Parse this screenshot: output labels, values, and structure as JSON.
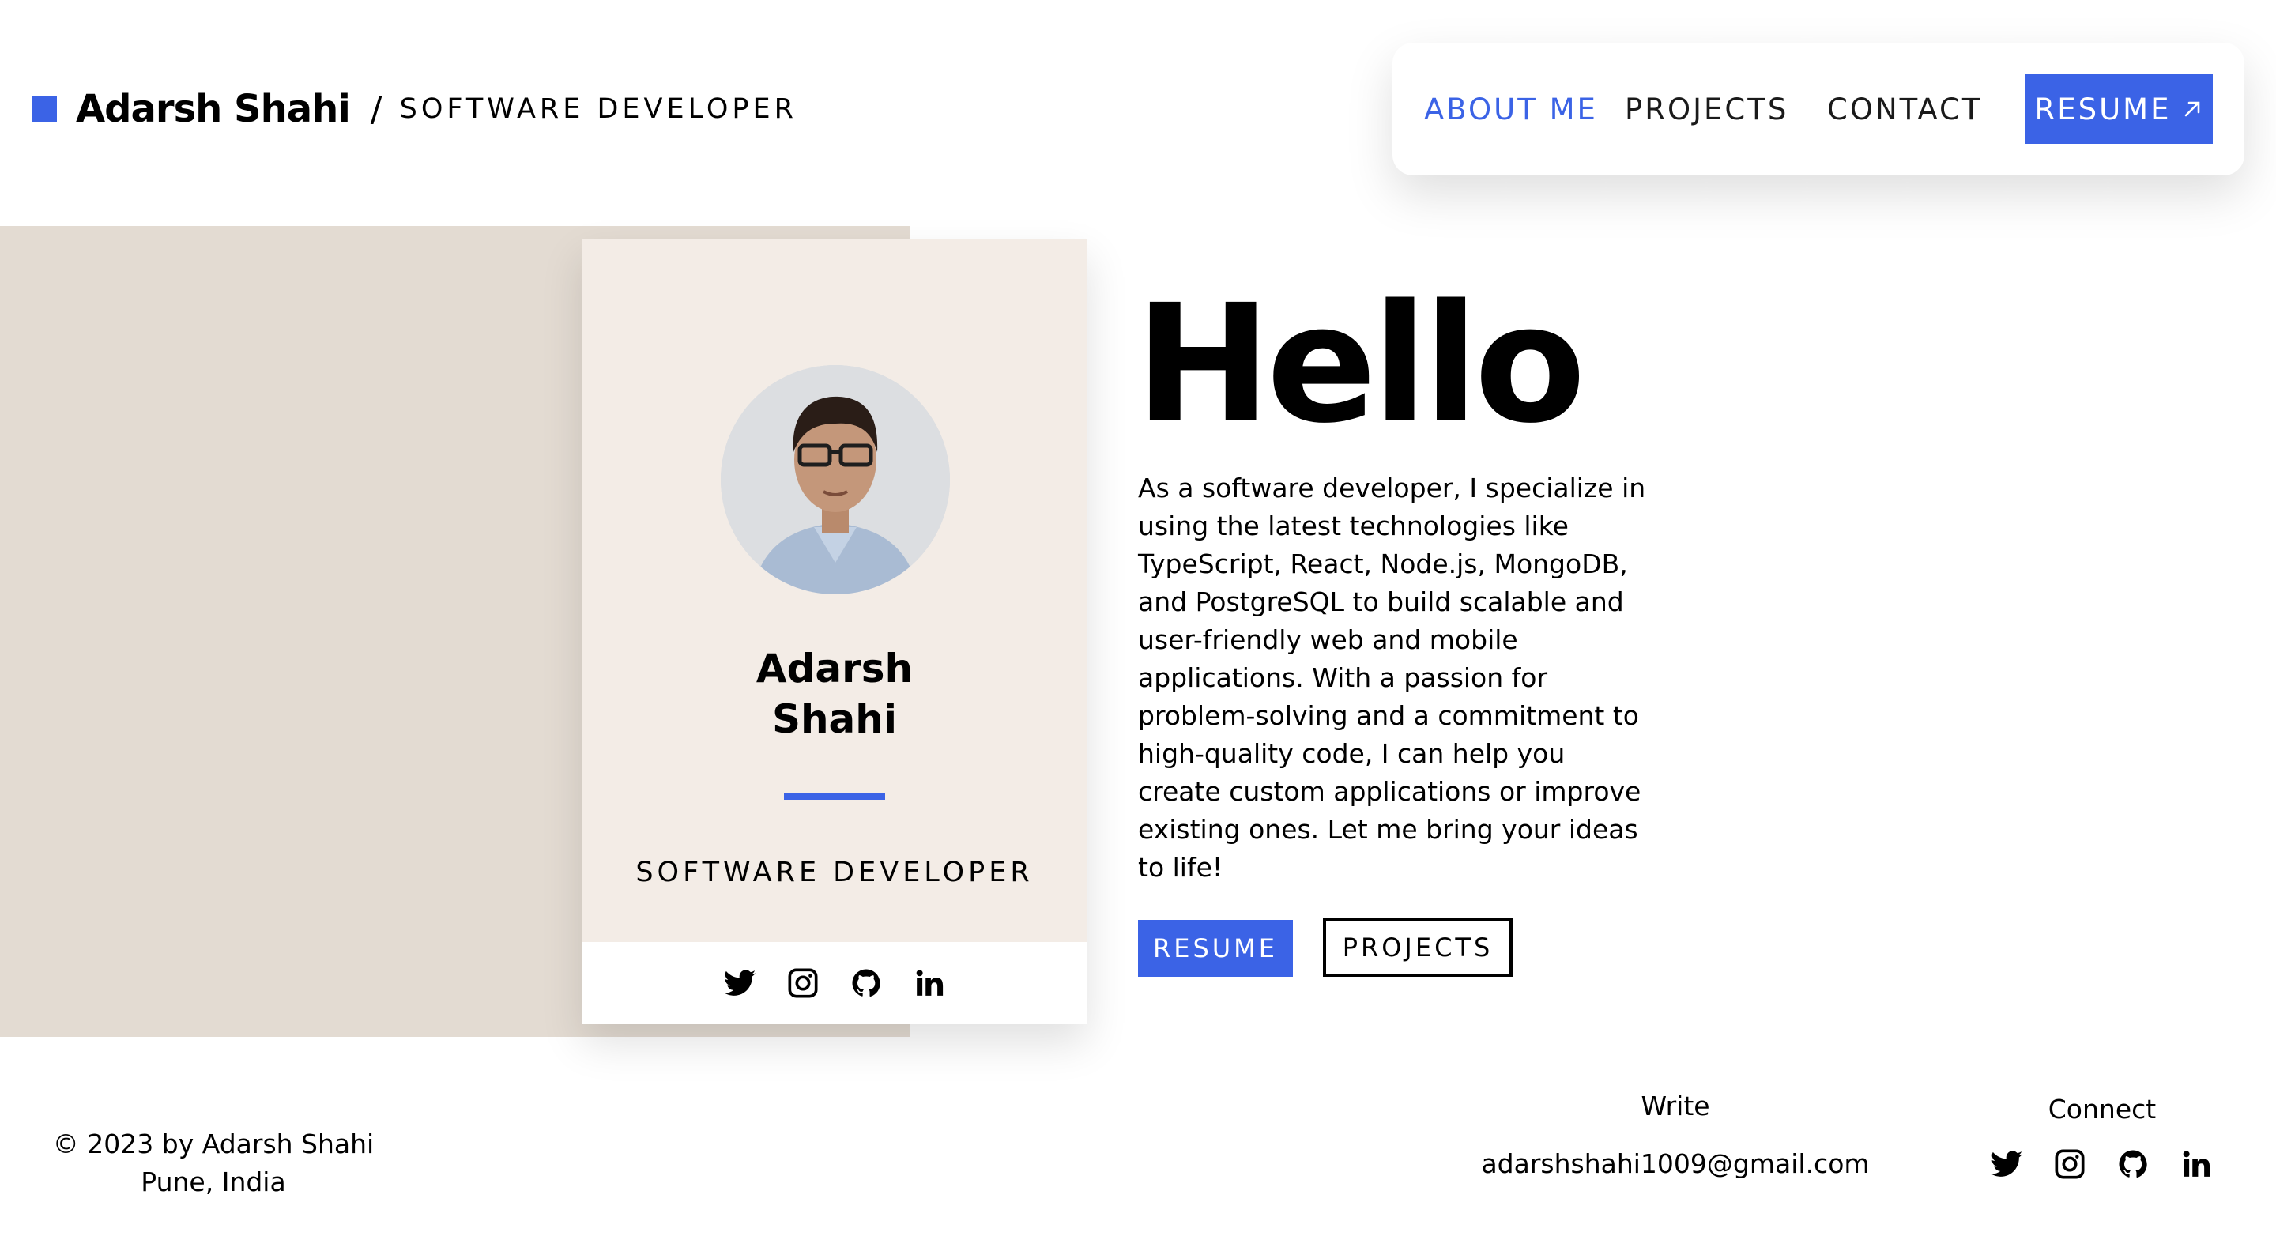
{
  "header": {
    "brand_name": "Adarsh Shahi",
    "brand_separator": "/",
    "brand_role": "SOFTWARE DEVELOPER",
    "brand_square_color": "#3b63e6"
  },
  "nav": {
    "items": [
      {
        "label": "ABOUT ME",
        "active": true
      },
      {
        "label": "PROJECTS",
        "active": false
      },
      {
        "label": "CONTACT",
        "active": false
      }
    ],
    "resume_label": "RESUME",
    "resume_icon": "arrow-up-right-icon"
  },
  "card": {
    "name_first": "Adarsh",
    "name_last": "Shahi",
    "role": "SOFTWARE DEVELOPER",
    "social_icons": [
      "twitter-icon",
      "instagram-icon",
      "github-icon",
      "linkedin-icon"
    ]
  },
  "hero": {
    "heading": "Hello",
    "bio": "As a software developer, I specialize in using the latest technologies like TypeScript, React, Node.js, MongoDB, and PostgreSQL to build scalable and user-friendly web and mobile applications. With a passion for problem-solving and a commitment to high-quality code, I can help you create custom applications or improve existing ones. Let me bring your ideas to life!",
    "resume_button": "RESUME",
    "projects_button": "PROJECTS"
  },
  "footer": {
    "copyright": "© 2023 by Adarsh Shahi",
    "location": "Pune, India",
    "write_label": "Write",
    "email": "adarshshahi1009@gmail.com",
    "connect_label": "Connect",
    "social_icons": [
      "twitter-icon",
      "instagram-icon",
      "github-icon",
      "linkedin-icon"
    ]
  },
  "colors": {
    "accent": "#3b63e6",
    "beige": "#e3dbd2",
    "card_bg": "#f3ece6"
  }
}
